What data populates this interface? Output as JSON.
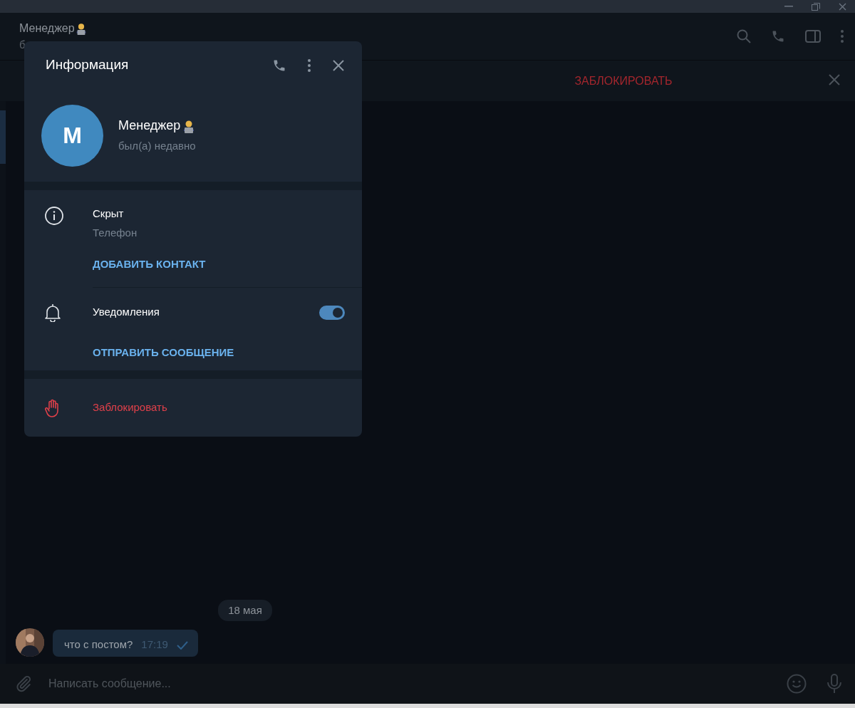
{
  "chat_header": {
    "title": "Менеджер",
    "subtitle": "б"
  },
  "block_bar": {
    "action": "ЗАБЛОКИРОВАТЬ"
  },
  "messages": [
    {
      "kind": "date",
      "text": "18 мая"
    },
    {
      "kind": "message",
      "text": "что с постом?",
      "time": "17:19"
    }
  ],
  "composer": {
    "placeholder": "Написать сообщение..."
  },
  "info_panel": {
    "title": "Информация",
    "avatar_letter": "М",
    "name": "Менеджер",
    "status": "был(а) недавно",
    "phone": {
      "value": "Скрыт",
      "label": "Телефон"
    },
    "add_contact": "ДОБАВИТЬ КОНТАКТ",
    "notifications": {
      "label": "Уведомления",
      "on": true
    },
    "send_message": "ОТПРАВИТЬ СООБЩЕНИЕ",
    "block": "Заблокировать"
  }
}
